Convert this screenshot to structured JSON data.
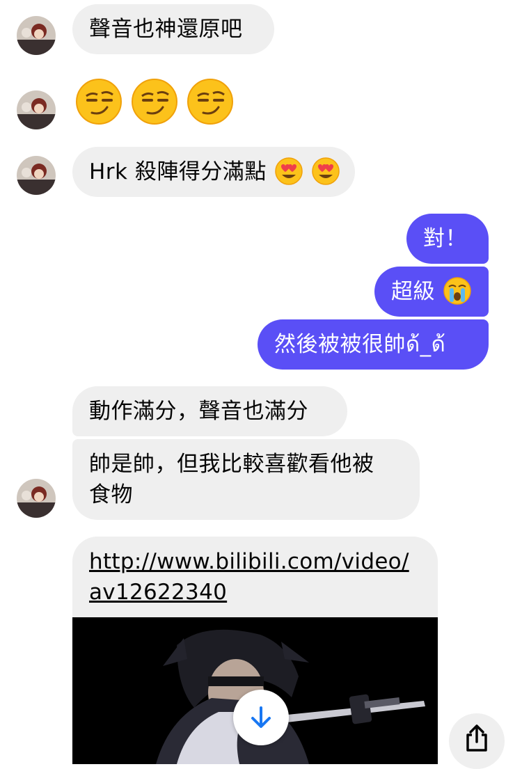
{
  "colors": {
    "incoming_bubble": "#efefef",
    "outgoing_bubble": "#5a4ff6",
    "download_icon": "#1877f2"
  },
  "messages": {
    "m1": "聲音也神還原吧",
    "m2_emojis": [
      "smirk-emoji",
      "smirk-emoji",
      "smirk-emoji"
    ],
    "m3_text": "Hrk 殺陣得分滿點",
    "m3_emojis": [
      "heart-eyes-emoji",
      "heart-eyes-emoji"
    ],
    "m4": "對！",
    "m5_text": "超級",
    "m5_emoji": "loudly-crying-emoji",
    "m6": "然後被被很帥ด้_ด้",
    "m7": "動作滿分，聲音也滿分",
    "m8_line1": "帥是帥，但我比較喜歡看他被",
    "m8_line2": "食物",
    "m9_line1": "http://www.bilibili.com/video/",
    "m9_line2": "av12622340"
  },
  "icons": {
    "download": "download-arrow-icon",
    "share": "share-icon"
  }
}
